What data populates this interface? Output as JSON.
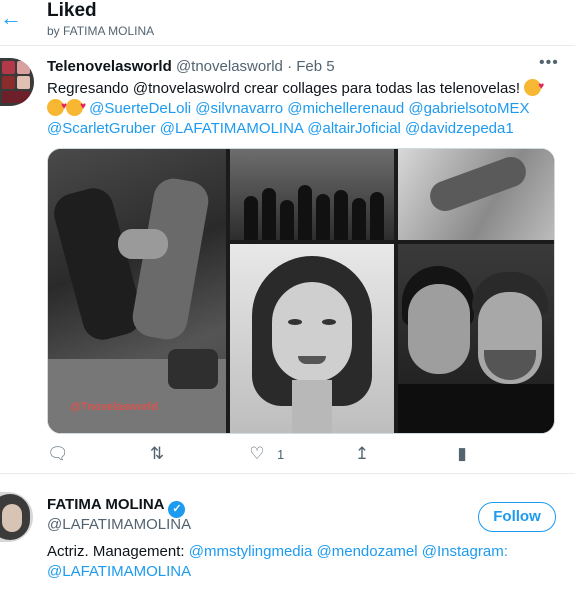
{
  "header": {
    "back_icon": "arrow-left-icon",
    "title": "Liked",
    "subtitle": "by FATIMA MOLINA"
  },
  "tweet": {
    "name": "Telenovelasworld",
    "handle": "@tnovelasworld",
    "dot": "·",
    "date": "Feb 5",
    "more_icon": "more-icon",
    "text_start": "Regresando @tnovelaswolrd crear collages para todas las telenovelas!",
    "mentions": [
      "@SuerteDeLoli",
      "@silvnavarro",
      "@michellerenaud",
      "@gabrielsotoMEX",
      "@ScarletGruber",
      "@LAFATIMAMOLINA",
      "@altairJoficial",
      "@davidzepeda1"
    ],
    "media_watermark": "@Tnovelasworld",
    "actions": {
      "reply_icon": "reply-icon",
      "retweet_icon": "retweet-icon",
      "like_icon": "heart-icon",
      "like_count": "1",
      "share_icon": "share-icon",
      "analytics_icon": "analytics-icon"
    }
  },
  "user_card": {
    "name": "FATIMA MOLINA",
    "verified_icon": "verified-badge-icon",
    "handle": "@LAFATIMAMOLINA",
    "follow_label": "Follow",
    "bio_text": "Actriz. Management:",
    "bio_mentions": [
      "@mmstylingmedia",
      "@mendozamel",
      "@Instagram:",
      "@LAFATIMAMOLINA"
    ]
  },
  "colors": {
    "accent": "#1d9bf0",
    "text": "#0f1419",
    "muted": "#536471",
    "border": "#e6ecf0"
  }
}
